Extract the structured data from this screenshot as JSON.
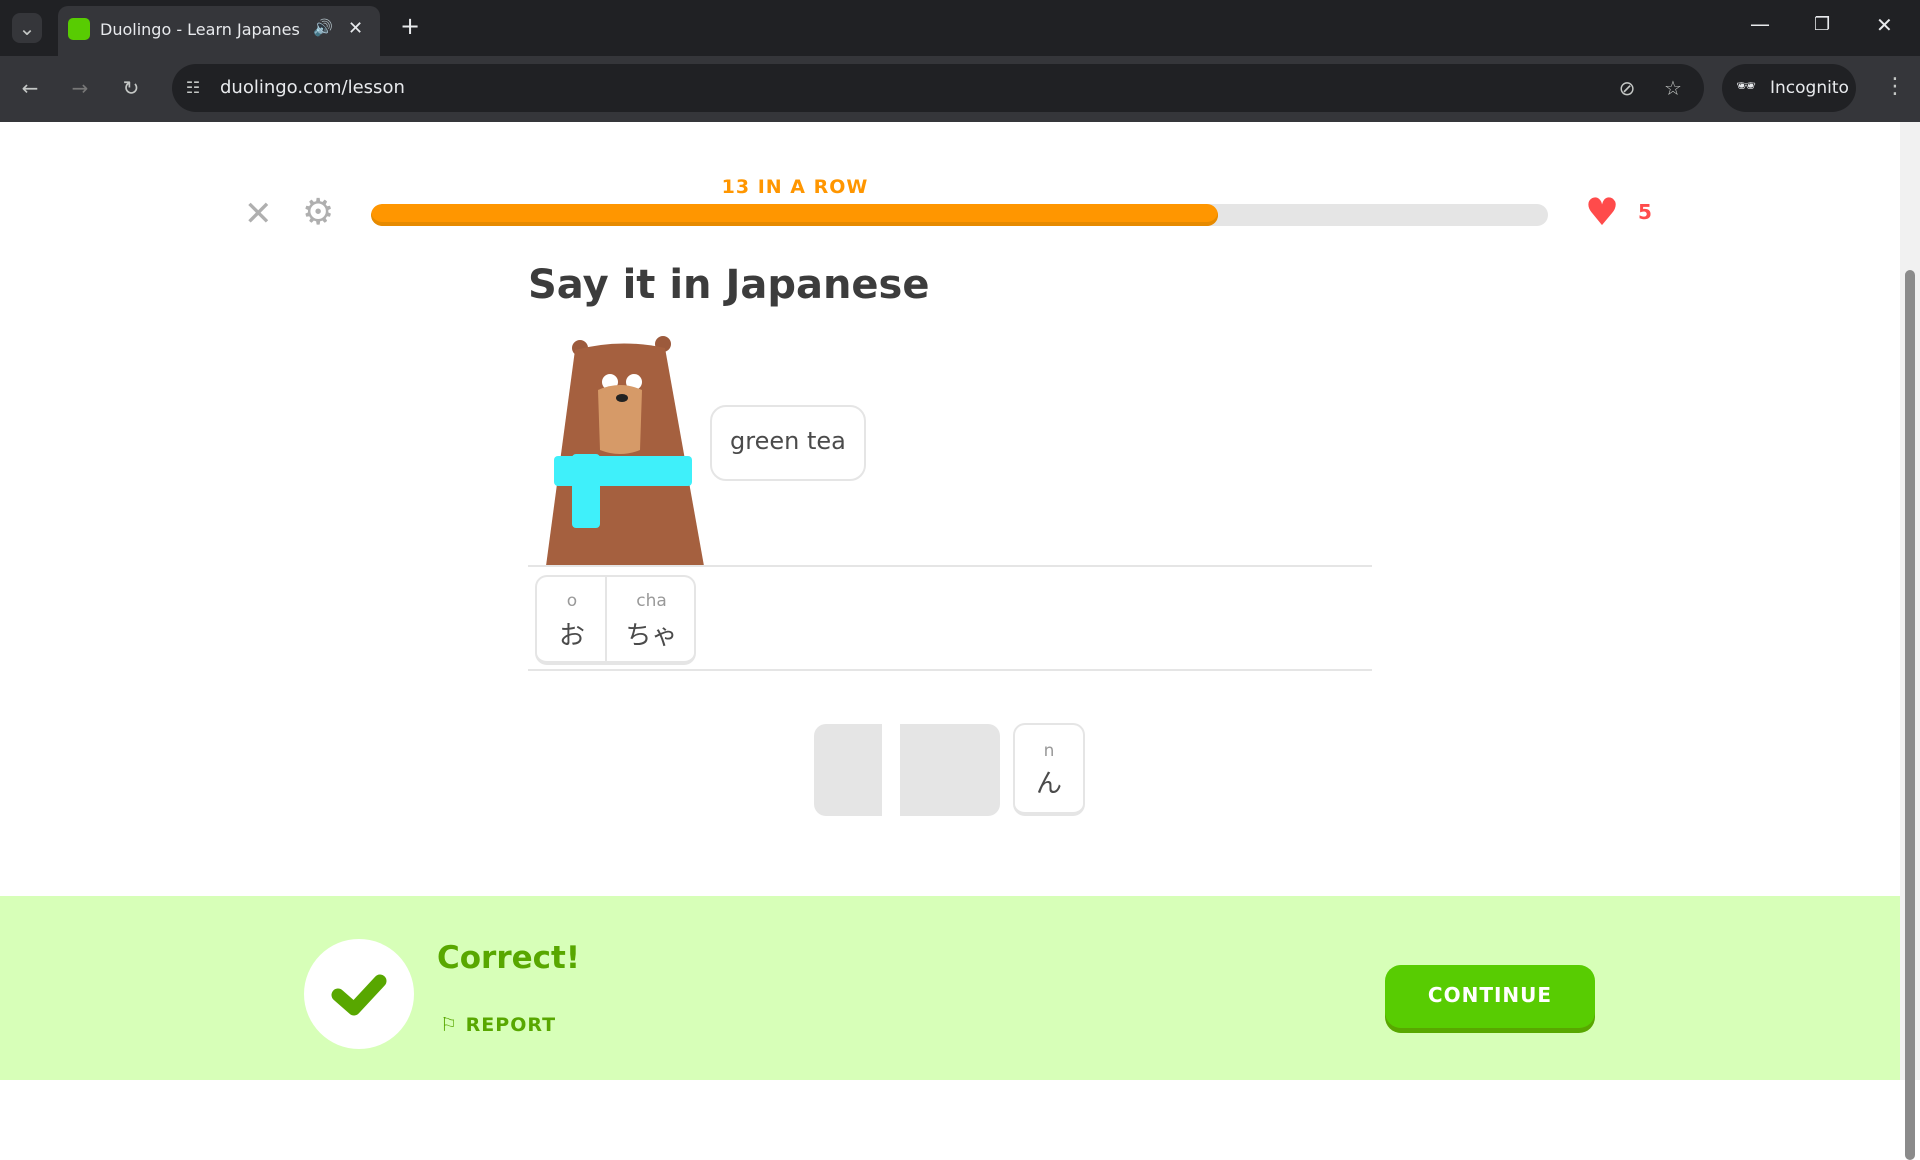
{
  "browser": {
    "tab_title": "Duolingo - Learn Japanese",
    "url": "duolingo.com/lesson",
    "incognito_label": "Incognito"
  },
  "lesson": {
    "streak_label": "13 IN A ROW",
    "progress_percent": 72,
    "hearts": "5",
    "title": "Say it in Japanese",
    "speech": "green tea",
    "answer_tiles": [
      {
        "romaji": "o",
        "kana": "お"
      },
      {
        "romaji": "cha",
        "kana": "ちゃ"
      }
    ],
    "bank_tiles": [
      {
        "romaji": "n",
        "kana": "ん"
      }
    ]
  },
  "feedback": {
    "status": "Correct!",
    "report_label": "REPORT",
    "continue_label": "CONTINUE"
  },
  "colors": {
    "accent": "#58cc02",
    "progress": "#ff9600",
    "heart": "#ff4b4b",
    "footer": "#d7ffb8"
  }
}
